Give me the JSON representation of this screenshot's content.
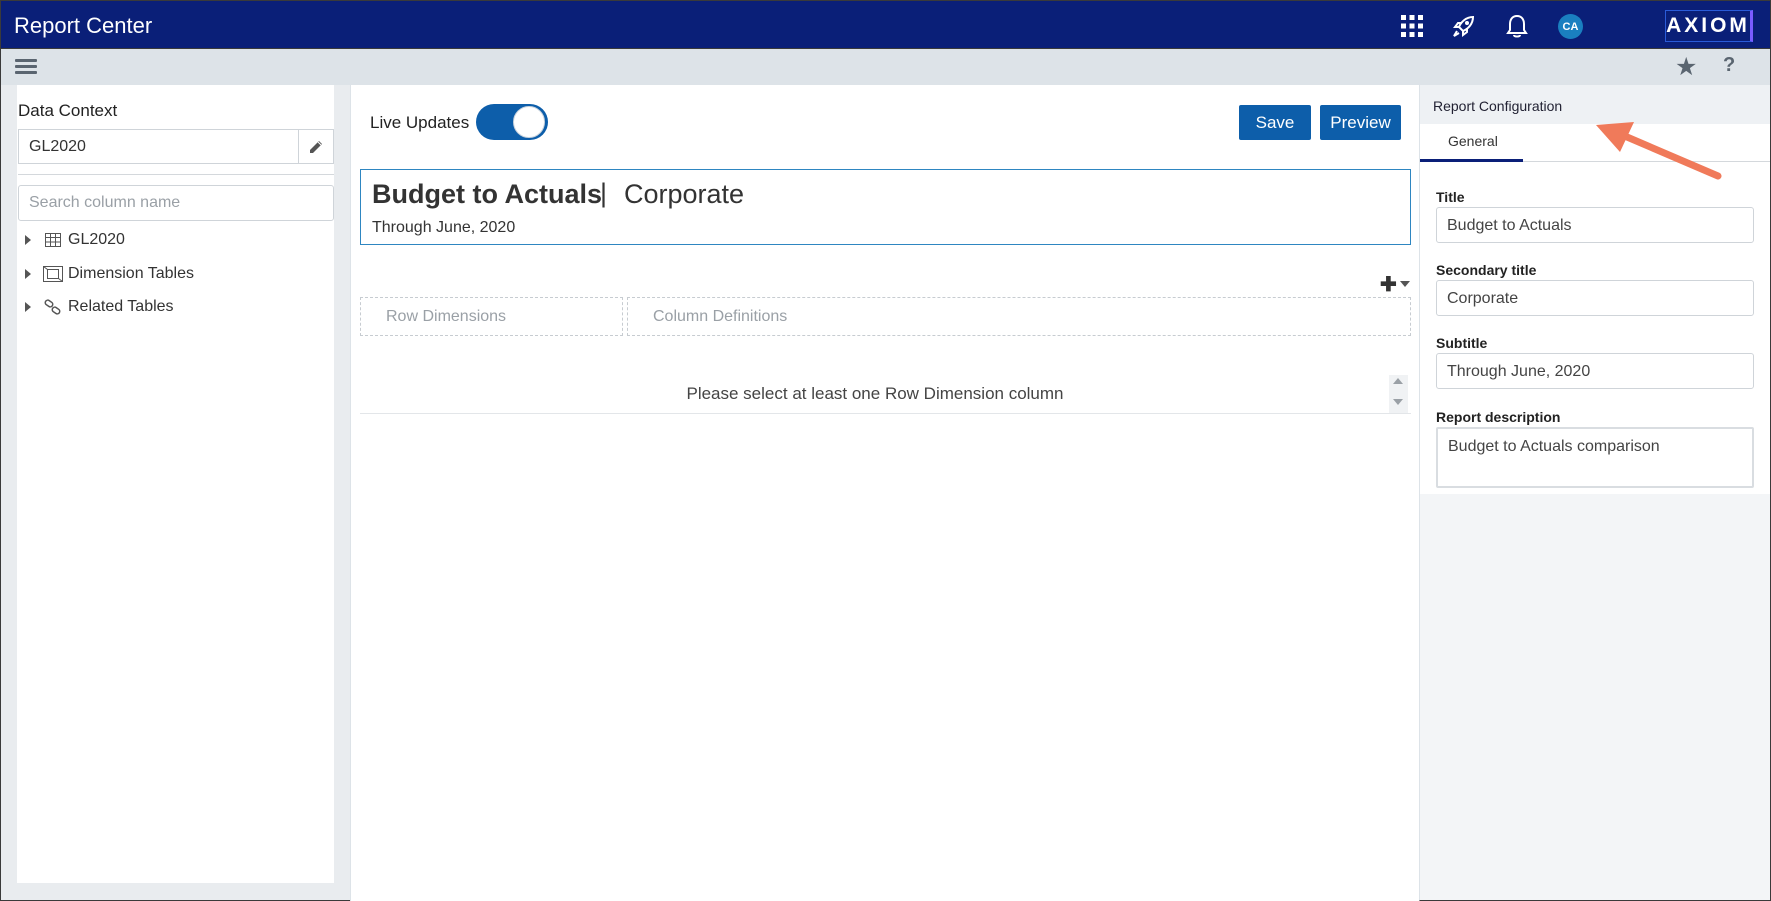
{
  "app": {
    "title": "Report Center",
    "logo": "AXIOM",
    "avatar_initials": "CA"
  },
  "topbar_icons": [
    "apps-grid-icon",
    "rocket-icon",
    "bell-icon"
  ],
  "subbar": {
    "icons": [
      "hamburger-menu-icon",
      "star-icon",
      "help-icon"
    ],
    "help_glyph": "?"
  },
  "left": {
    "data_context_label": "Data Context",
    "data_context_value": "GL2020",
    "search_placeholder": "Search column name",
    "tree": [
      {
        "label": "GL2020",
        "icon": "table-icon"
      },
      {
        "label": "Dimension Tables",
        "icon": "dimension-table-icon"
      },
      {
        "label": "Related Tables",
        "icon": "link-icon"
      }
    ]
  },
  "center": {
    "live_updates_label": "Live Updates",
    "live_updates_on": true,
    "save_label": "Save",
    "preview_label": "Preview",
    "report": {
      "title": "Budget to Actuals",
      "separator": "|",
      "secondary_title": "Corporate",
      "subtitle": "Through June, 2020"
    },
    "row_dimensions_label": "Row Dimensions",
    "column_definitions_label": "Column Definitions",
    "empty_message": "Please select at least one Row Dimension column"
  },
  "right": {
    "header": "Report Configuration",
    "tab": "General",
    "fields": {
      "title_label": "Title",
      "title_value": "Budget to Actuals",
      "secondary_label": "Secondary title",
      "secondary_value": "Corporate",
      "subtitle_label": "Subtitle",
      "subtitle_value": "Through June, 2020",
      "description_label": "Report description",
      "description_value": "Budget to Actuals comparison"
    }
  },
  "colors": {
    "topbar": "#0a1f78",
    "accent": "#0d5eaa",
    "arrow": "#f07a5a"
  }
}
